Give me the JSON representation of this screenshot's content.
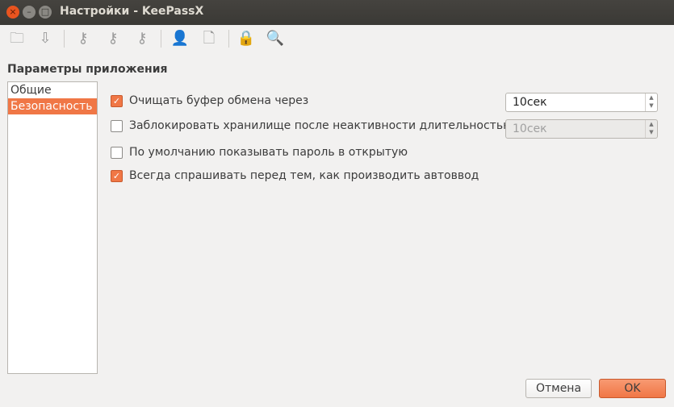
{
  "window": {
    "title": "Настройки - KeePassX"
  },
  "toolbar": {
    "icons": [
      "open-folder-icon",
      "save-icon",
      "add-key-icon",
      "edit-key-icon",
      "delete-key-icon",
      "user-document-icon",
      "lock-document-icon",
      "lock-icon",
      "search-icon"
    ]
  },
  "heading": "Параметры приложения",
  "sidebar": {
    "items": [
      {
        "label": "Общие"
      },
      {
        "label": "Безопасность"
      }
    ]
  },
  "options": [
    {
      "label": "Очищать буфер обмена через",
      "checked": true
    },
    {
      "label": "Заблокировать хранилище после неактивности длительностью",
      "checked": false
    },
    {
      "label": "По умолчанию показывать пароль в открытую",
      "checked": false
    },
    {
      "label": "Всегда спрашивать перед тем, как производить автоввод",
      "checked": true
    }
  ],
  "spinboxes": {
    "clear_clipboard": "10сек",
    "lock_timeout": "10сек"
  },
  "buttons": {
    "cancel": "Отмена",
    "ok": "OK"
  },
  "colors": {
    "accent": "#f07746"
  }
}
